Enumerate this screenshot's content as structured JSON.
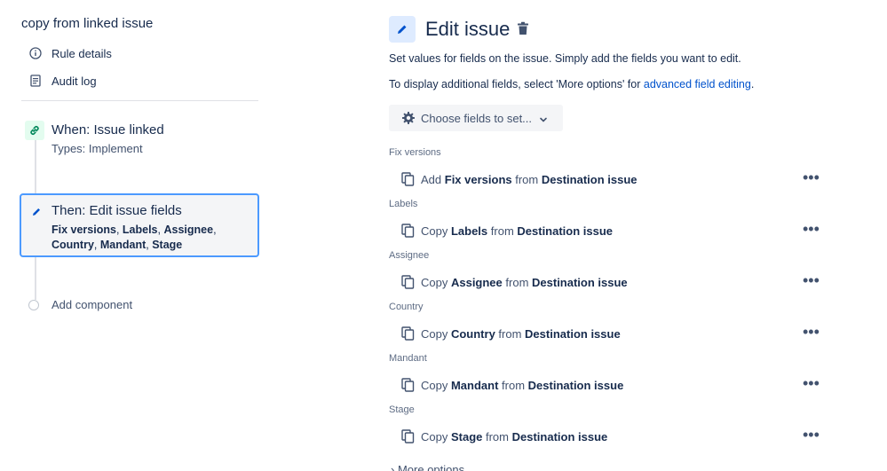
{
  "sidebar": {
    "rule_title": "copy from linked issue",
    "rule_details": "Rule details",
    "audit_log": "Audit log",
    "add_component": "Add component"
  },
  "trigger": {
    "title": "When: Issue linked",
    "subtitle": "Types: Implement"
  },
  "action": {
    "title": "Then: Edit issue fields",
    "fields": [
      "Fix versions",
      "Labels",
      "Assignee",
      "Country",
      "Mandant",
      "Stage"
    ],
    "separator": ", "
  },
  "editor": {
    "title": "Edit issue",
    "description": "Set values for fields on the issue. Simply add the fields you want to edit.",
    "additional_prefix": "To display additional fields, select 'More options' for ",
    "additional_link": "advanced field editing",
    "additional_suffix": ".",
    "choose_button": "Choose fields to set...",
    "more_options": "More options"
  },
  "field_groups": [
    {
      "label": "Fix versions",
      "verb": "Add",
      "field": "Fix versions",
      "from": "from",
      "source": "Destination issue"
    },
    {
      "label": "Labels",
      "verb": "Copy",
      "field": "Labels",
      "from": "from",
      "source": "Destination issue"
    },
    {
      "label": "Assignee",
      "verb": "Copy",
      "field": "Assignee",
      "from": "from",
      "source": "Destination issue"
    },
    {
      "label": "Country",
      "verb": "Copy",
      "field": "Country",
      "from": "from",
      "source": "Destination issue"
    },
    {
      "label": "Mandant",
      "verb": "Copy",
      "field": "Mandant",
      "from": "from",
      "source": "Destination issue"
    },
    {
      "label": "Stage",
      "verb": "Copy",
      "field": "Stage",
      "from": "from",
      "source": "Destination issue"
    }
  ],
  "more_menu": "•••",
  "icons": {
    "rule_details": "info-icon",
    "audit_log": "document-icon",
    "trigger": "link-icon",
    "action": "pencil-icon",
    "delete": "trash-icon",
    "choose": "gear-icon",
    "field": "copy-icon"
  },
  "colors": {
    "accent": "#0052cc",
    "selected_border": "#4c9aff",
    "trigger_badge": "#e3fcef",
    "link_icon": "#00875a"
  }
}
